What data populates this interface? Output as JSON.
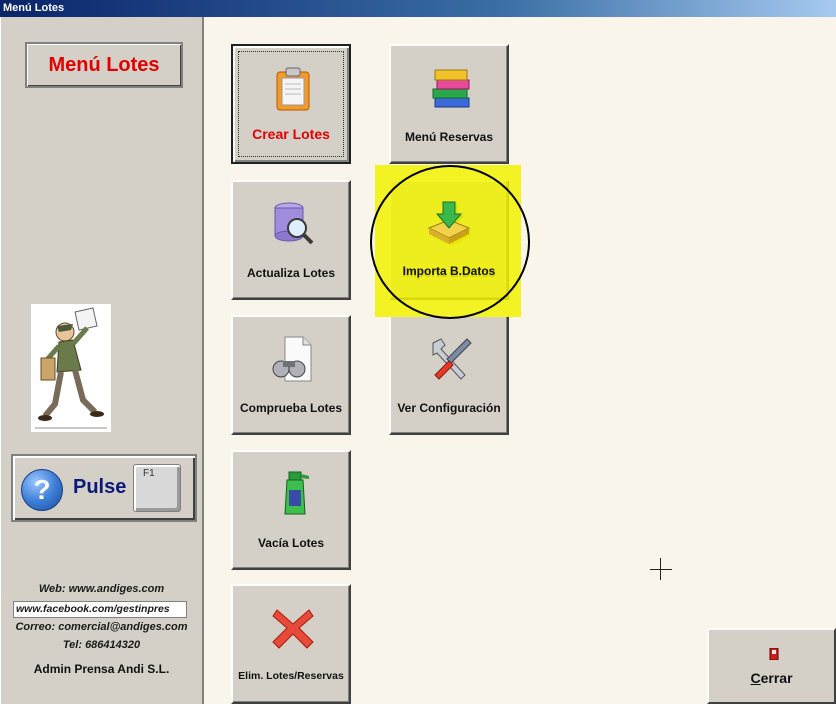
{
  "window": {
    "title": "Menú Lotes"
  },
  "sidebar": {
    "menu_title": "Menú Lotes",
    "help": {
      "pulse_label": "Pulse",
      "key_label": "F1"
    },
    "web": "Web: www.andiges.com",
    "facebook": "www.facebook.com/gestinpres",
    "email": "Correo: comercial@andiges.com",
    "phone": "Tel: 686414320",
    "company": "Admin Prensa Andi S.L."
  },
  "buttons": {
    "crear_lotes": {
      "label": "Crear Lotes",
      "icon": "clipboard-icon"
    },
    "menu_reservas": {
      "label": "Menú Reservas",
      "icon": "books-icon"
    },
    "actualiza_lotes": {
      "label": "Actualiza Lotes",
      "icon": "database-search-icon"
    },
    "importa_bdatos": {
      "label": "Importa B.Datos",
      "icon": "import-icon"
    },
    "comprueba_lotes": {
      "label": "Comprueba Lotes",
      "icon": "binoculars-document-icon"
    },
    "ver_configuracion": {
      "label": "Ver Configuración",
      "icon": "tools-icon"
    },
    "vacia_lotes": {
      "label": "Vacía Lotes",
      "icon": "spray-bottle-icon"
    },
    "elim_lotes_reservas": {
      "label": "Elim. Lotes/Reservas",
      "icon": "delete-x-icon"
    }
  },
  "footer": {
    "close_label_underlined": "C",
    "close_label_rest": "errar"
  },
  "colors": {
    "accent_red": "#e00000",
    "highlight_yellow": "#f2f200",
    "titlebar": "#0a246a"
  }
}
